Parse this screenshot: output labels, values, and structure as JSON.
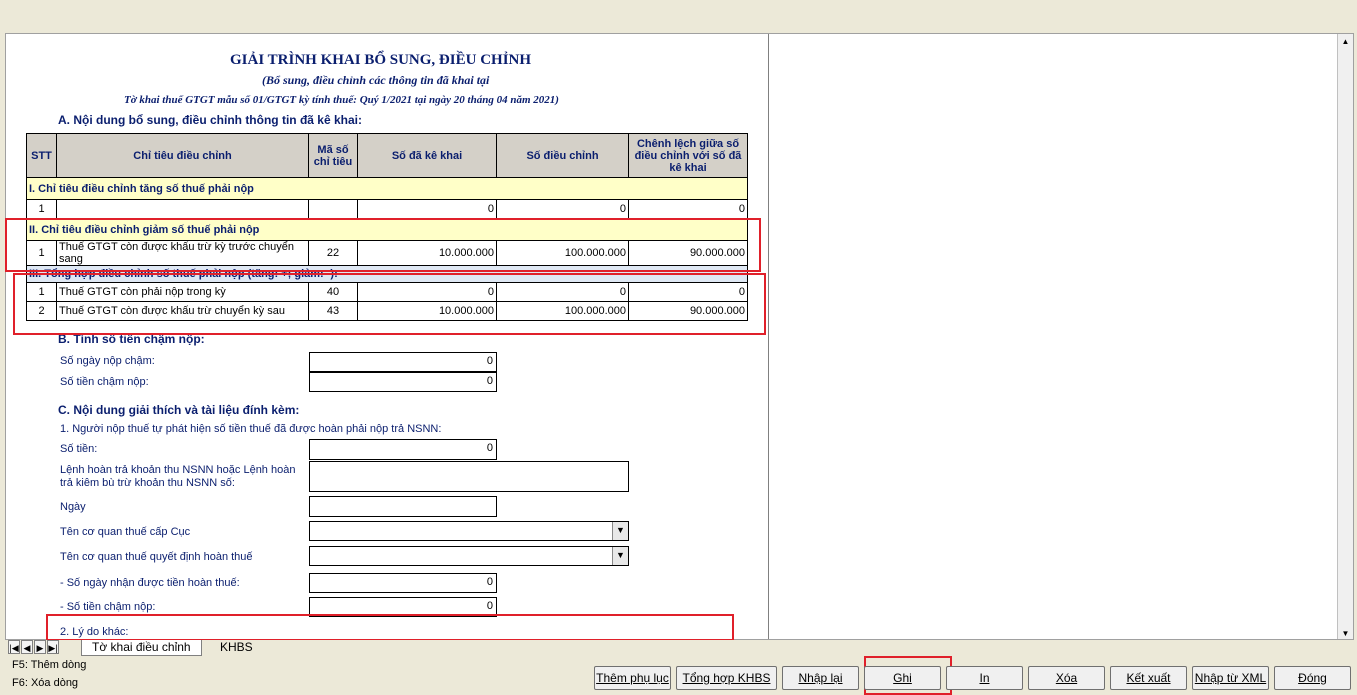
{
  "form": {
    "title": "GIẢI TRÌNH KHAI BỔ SUNG, ĐIỀU CHỈNH",
    "subtitle": "(Bổ sung, điều chỉnh các thông tin đã khai tại",
    "subtitle2": "Tờ khai thuế GTGT mẫu số 01/GTGT kỳ tính thuế: Quý 1/2021 tại ngày 20 tháng 04 năm 2021)",
    "sectionA": "A. Nội dung bổ sung, điều chỉnh thông tin đã kê khai:",
    "headers": {
      "stt": "STT",
      "chi_tieu": "Chỉ tiêu điều chỉnh",
      "ma_so": "Mã số chỉ tiêu",
      "so_da_ke_khai": "Số đã kê khai",
      "so_dieu_chinh": "Số điều chỉnh",
      "chenh_lech": "Chênh lệch giữa số điều chỉnh với số đã kê khai"
    },
    "sec1": "I. Chỉ tiêu điều chỉnh tăng số thuế phải nộp",
    "sec1_rows": [
      {
        "stt": "1",
        "name": "",
        "code": "",
        "declared": "0",
        "adjusted": "0",
        "diff": "0"
      }
    ],
    "sec2": "II. Chỉ tiêu điều chỉnh giảm số thuế phải nộp",
    "sec2_rows": [
      {
        "stt": "1",
        "name": "Thuế GTGT còn được khấu trừ kỳ trước chuyển sang",
        "code": "22",
        "declared": "10.000.000",
        "adjusted": "100.000.000",
        "diff": "90.000.000"
      }
    ],
    "sec3": "III. Tổng hợp điều chỉnh số thuế phải nộp (tăng: +; giảm: -):",
    "sec3_rows": [
      {
        "stt": "1",
        "name": "Thuế GTGT còn phải nộp trong kỳ",
        "code": "40",
        "declared": "0",
        "adjusted": "0",
        "diff": "0"
      },
      {
        "stt": "2",
        "name": "Thuế GTGT còn được khấu trừ chuyển kỳ sau",
        "code": "43",
        "declared": "10.000.000",
        "adjusted": "100.000.000",
        "diff": "90.000.000"
      }
    ],
    "sectionB": "B. Tính số tiền chậm nộp:",
    "b_days_label": "Số ngày nộp chậm:",
    "b_days_value": "0",
    "b_amount_label": "Số tiền chậm nộp:",
    "b_amount_value": "0",
    "sectionC": "C. Nội dung giải thích và tài liệu đính kèm:",
    "c1": "1. Người nộp thuế tự phát hiện số tiền thuế đã được hoàn phải nộp trả NSNN:",
    "c_amount_label": "Số tiền:",
    "c_amount_value": "0",
    "c_order_label": "Lệnh hoàn trả khoản thu NSNN hoặc Lệnh hoàn trả kiêm bù trừ khoản thu NSNN số:",
    "c_order_value": "",
    "c_date_label": "Ngày",
    "c_date_value": "",
    "c_tax_office_label": "Tên cơ quan thuế cấp Cục",
    "c_tax_office_value": "",
    "c_decide_label": "Tên cơ quan thuế quyết định hoàn thuế",
    "c_decide_value": "",
    "c_days_label": "- Số ngày nhận được tiền hoàn thuế:",
    "c_days_value": "0",
    "c_late_label": "- Số tiền chậm nộp:",
    "c_late_value": "0",
    "c2": "2. Lý do khác:"
  },
  "tabs": [
    {
      "label": "Tờ khai điều chỉnh"
    },
    {
      "label": "KHBS"
    }
  ],
  "hints": [
    "F5: Thêm dòng",
    "F6: Xóa dòng"
  ],
  "buttons": [
    {
      "label": "Thêm phụ lục"
    },
    {
      "label": "Tổng hợp KHBS"
    },
    {
      "label": "Nhập lại"
    },
    {
      "label": "Ghi"
    },
    {
      "label": "In"
    },
    {
      "label": "Xóa"
    },
    {
      "label": "Kết xuất"
    },
    {
      "label": "Nhập từ XML"
    },
    {
      "label": "Đóng"
    }
  ],
  "colors": {
    "highlight": "#e0202a",
    "heading": "#0a1e6e",
    "section_bg": "#ffffc8"
  }
}
